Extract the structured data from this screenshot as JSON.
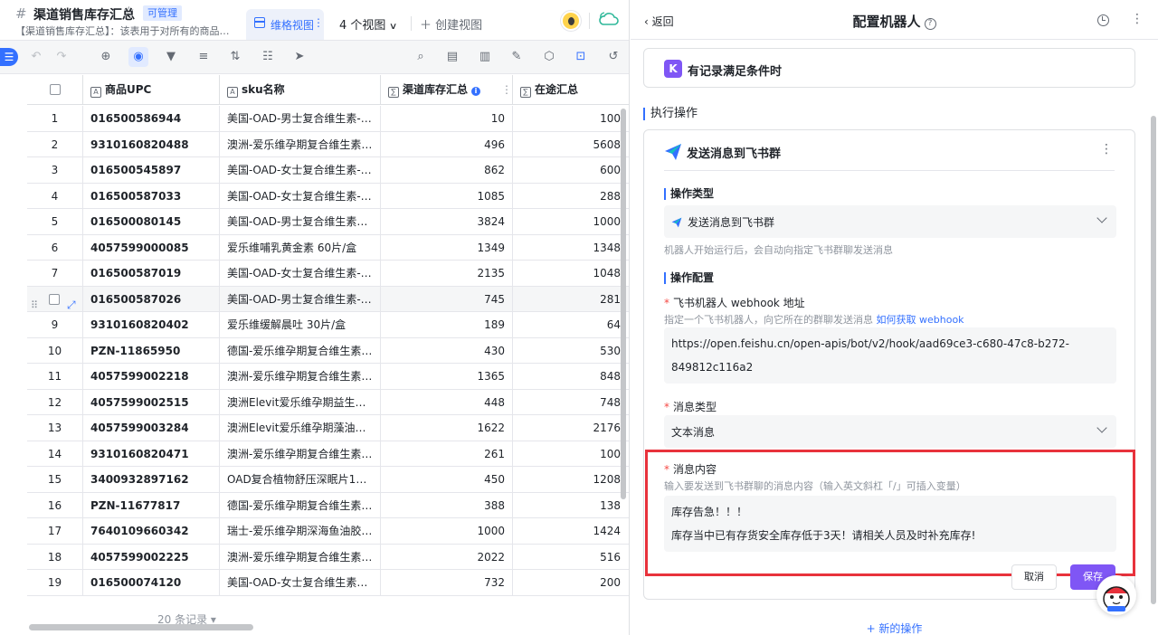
{
  "header": {
    "doc_title": "渠道销售库存汇总",
    "badge": "可管理",
    "desc": "【渠道销售库存汇总】：该表用于对所有的商品进行库存汇总",
    "active_tab": "维格视图",
    "views_count": "4 个视图",
    "create_view": "创建视图"
  },
  "grid": {
    "columns": [
      "商品UPC",
      "sku名称",
      "渠道库存汇总",
      "在途汇总"
    ],
    "rows": [
      {
        "idx": "1",
        "upc": "016500586944",
        "sku": "美国-OAD-男士复合维生素-1…",
        "stock": "10",
        "transit": "100"
      },
      {
        "idx": "2",
        "upc": "9310160820488",
        "sku": "澳洲-爱乐维孕期复合维生素-…",
        "stock": "496",
        "transit": "5608"
      },
      {
        "idx": "3",
        "upc": "016500545897",
        "sku": "美国-OAD-女士复合维生素-…",
        "stock": "862",
        "transit": "600"
      },
      {
        "idx": "4",
        "upc": "016500587033",
        "sku": "美国-OAD-女士复合维生素-…",
        "stock": "1085",
        "transit": "288"
      },
      {
        "idx": "5",
        "upc": "016500080145",
        "sku": "美国-OAD-男士复合维生素…",
        "stock": "3824",
        "transit": "1000"
      },
      {
        "idx": "6",
        "upc": "4057599000085",
        "sku": "爱乐维哺乳黄金素 60片/盒",
        "stock": "1349",
        "transit": "1348"
      },
      {
        "idx": "7",
        "upc": "016500587019",
        "sku": "美国-OAD-女士复合维生素-…",
        "stock": "2135",
        "transit": "1048"
      },
      {
        "idx": "",
        "upc": "016500587026",
        "sku": "美国-OAD-男士复合维生素-…",
        "stock": "745",
        "transit": "281"
      },
      {
        "idx": "9",
        "upc": "9310160820402",
        "sku": "爱乐维缓解晨吐 30片/盒",
        "stock": "189",
        "transit": "64"
      },
      {
        "idx": "10",
        "upc": "PZN-11865950",
        "sku": "德国-爱乐维孕期复合维生素-…",
        "stock": "430",
        "transit": "530"
      },
      {
        "idx": "11",
        "upc": "4057599002218",
        "sku": "澳洲-爱乐维孕期复合维生素-…",
        "stock": "1365",
        "transit": "848"
      },
      {
        "idx": "12",
        "upc": "4057599002515",
        "sku": "澳洲Elevit爱乐维孕期益生菌…",
        "stock": "448",
        "transit": "748"
      },
      {
        "idx": "13",
        "upc": "4057599003284",
        "sku": "澳洲Elevit爱乐维孕期藻油DH…",
        "stock": "1622",
        "transit": "2176"
      },
      {
        "idx": "14",
        "upc": "9310160820471",
        "sku": "澳洲-爱乐维孕期复合维生素-…",
        "stock": "261",
        "transit": "100"
      },
      {
        "idx": "15",
        "upc": "3400932897162",
        "sku": "OAD复合植物舒压深眠片120粒",
        "stock": "450",
        "transit": "1208"
      },
      {
        "idx": "16",
        "upc": "PZN-11677817",
        "sku": "德国-爱乐维孕期复合维生素-…",
        "stock": "388",
        "transit": "138"
      },
      {
        "idx": "17",
        "upc": "7640109660342",
        "sku": "瑞士-爱乐维孕期深海鱼油胶…",
        "stock": "1000",
        "transit": "1424"
      },
      {
        "idx": "18",
        "upc": "4057599002225",
        "sku": "澳洲-爱乐维孕期复合维生素-…",
        "stock": "2022",
        "transit": "516"
      },
      {
        "idx": "19",
        "upc": "016500074120",
        "sku": "美国-OAD-女士复合维生素…",
        "stock": "732",
        "transit": "200"
      }
    ],
    "footer_count": "20 条记录 ▾"
  },
  "panel": {
    "back": "返回",
    "title": "配置机器人",
    "trigger": "有记录满足条件时",
    "exec_section": "执行操作",
    "action_name": "发送消息到飞书群",
    "op_type_label": "操作类型",
    "op_type_value": "发送消息到飞书群",
    "op_type_hint": "机器人开始运行后，会自动向指定飞书群聊发送消息",
    "op_config_label": "操作配置",
    "webhook_label": "飞书机器人 webhook 地址",
    "webhook_hint": "指定一个飞书机器人，向它所在的群聊发送消息",
    "webhook_link": "如何获取 webhook",
    "webhook_value": "https://open.feishu.cn/open-apis/bot/v2/hook/aad69ce3-c680-47c8-b272-849812c116a2",
    "msg_type_label": "消息类型",
    "msg_type_value": "文本消息",
    "msg_content_label": "消息内容",
    "msg_content_hint": "输入要发送到飞书群聊的消息内容（输入英文斜杠「/」可插入变量）",
    "msg_line1": "库存告急！！！",
    "msg_line2": "库存当中已有存货安全库存低于3天！请相关人员及时补充库存!",
    "cancel": "取消",
    "save": "保存",
    "new_action": "+ 新的操作"
  },
  "colors": {
    "accent": "#3370ff",
    "highlight": "#e8323c",
    "purple": "#7f56f5"
  }
}
